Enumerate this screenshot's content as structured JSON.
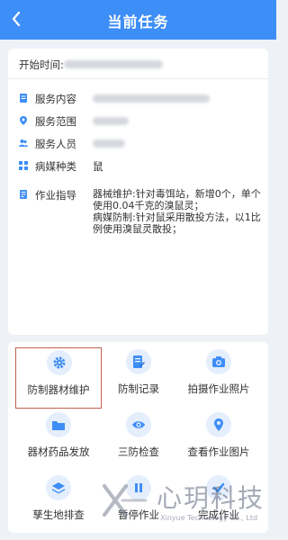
{
  "header": {
    "title": "当前任务"
  },
  "task": {
    "start_label": "开始时间:",
    "rows": [
      {
        "label": "服务内容"
      },
      {
        "label": "服务范围"
      },
      {
        "label": "服务人员"
      },
      {
        "label": "病媒种类",
        "value": "鼠"
      },
      {
        "label": "作业指导",
        "value": "器械维护:针对毒饵站，新增0个，单个使用0.04千克的溴鼠灵；\n病媒防制:针对鼠采用散投方法，以1比例使用溴鼠灵散投；"
      }
    ]
  },
  "actions": [
    {
      "label": "防制器材维护",
      "icon": "gear-icon",
      "selected": true
    },
    {
      "label": "防制记录",
      "icon": "document-edit-icon"
    },
    {
      "label": "拍摄作业照片",
      "icon": "camera-icon"
    },
    {
      "label": "器材药品发放",
      "icon": "folder-icon"
    },
    {
      "label": "三防检查",
      "icon": "eye-icon"
    },
    {
      "label": "查看作业图片",
      "icon": "location-pin-icon"
    },
    {
      "label": "孳生地排查",
      "icon": "layers-icon"
    },
    {
      "label": "暂停作业",
      "icon": "pause-icon"
    },
    {
      "label": "完成作业",
      "icon": "check-icon"
    }
  ],
  "watermark": {
    "cn": "心玥科技",
    "en": "Xinyue Technology Co., Ltd"
  },
  "colors": {
    "primary": "#3e8ef7",
    "icon_bg": "#e4eefc",
    "selected_border": "#c0604e"
  }
}
